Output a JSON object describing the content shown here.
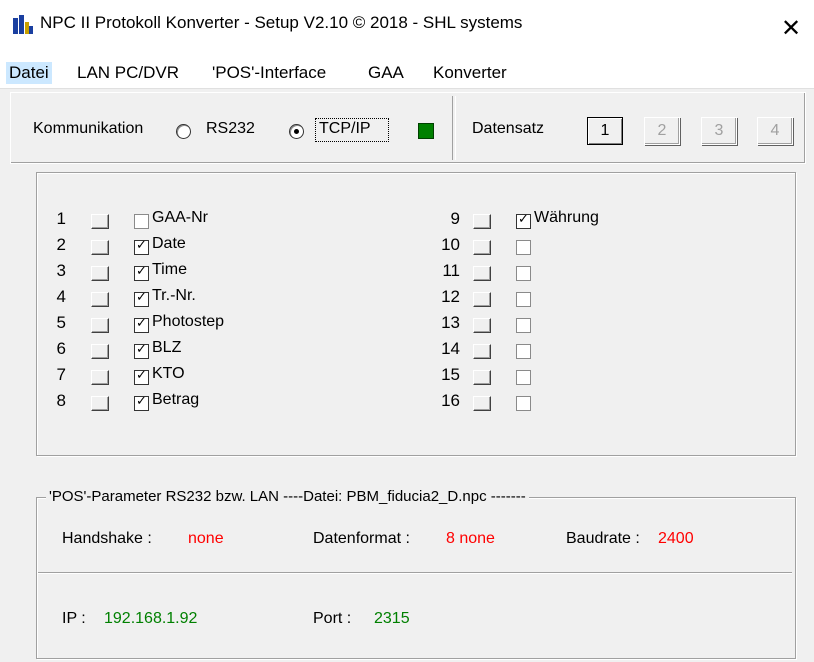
{
  "window": {
    "title": "NPC II Protokoll Konverter - Setup   V2.10   © 2018 - SHL systems",
    "close_symbol": "✕"
  },
  "menu": [
    "Datei",
    "LAN PC/DVR",
    "'POS'-Interface",
    "GAA",
    "Konverter"
  ],
  "kommunikation": {
    "label": "Kommunikation",
    "options": [
      {
        "label": "RS232",
        "selected": false
      },
      {
        "label": "TCP/IP",
        "selected": true
      }
    ],
    "status_color": "#008000"
  },
  "datensatz": {
    "label": "Datensatz",
    "buttons": [
      "1",
      "2",
      "3",
      "4"
    ],
    "active": "1"
  },
  "fields": [
    {
      "num": "1",
      "checked": false,
      "label": "GAA-Nr"
    },
    {
      "num": "2",
      "checked": true,
      "label": "Date"
    },
    {
      "num": "3",
      "checked": true,
      "label": "Time"
    },
    {
      "num": "4",
      "checked": true,
      "label": "Tr.-Nr."
    },
    {
      "num": "5",
      "checked": true,
      "label": "Photostep"
    },
    {
      "num": "6",
      "checked": true,
      "label": "BLZ"
    },
    {
      "num": "7",
      "checked": true,
      "label": "KTO"
    },
    {
      "num": "8",
      "checked": true,
      "label": "Betrag"
    },
    {
      "num": "9",
      "checked": true,
      "label": "Währung"
    },
    {
      "num": "10",
      "checked": false,
      "label": ""
    },
    {
      "num": "11",
      "checked": false,
      "label": ""
    },
    {
      "num": "12",
      "checked": false,
      "label": ""
    },
    {
      "num": "13",
      "checked": false,
      "label": ""
    },
    {
      "num": "14",
      "checked": false,
      "label": ""
    },
    {
      "num": "15",
      "checked": false,
      "label": ""
    },
    {
      "num": "16",
      "checked": false,
      "label": ""
    }
  ],
  "pos_params": {
    "caption": "'POS'-Parameter  RS232 bzw. LAN  ----Datei: PBM_fiducia2_D.npc -------",
    "handshake_label": "Handshake :",
    "handshake_value": "none",
    "datenformat_label": "Datenformat :",
    "datenformat_value": "8 none",
    "baudrate_label": "Baudrate :",
    "baudrate_value": "2400",
    "ip_label": "IP :",
    "ip_value": "192.168.1.92",
    "port_label": "Port :",
    "port_value": "2315"
  },
  "colors": {
    "value_red": "#ff0000",
    "value_green": "#008000",
    "menu_highlight": "#cce8ff"
  }
}
